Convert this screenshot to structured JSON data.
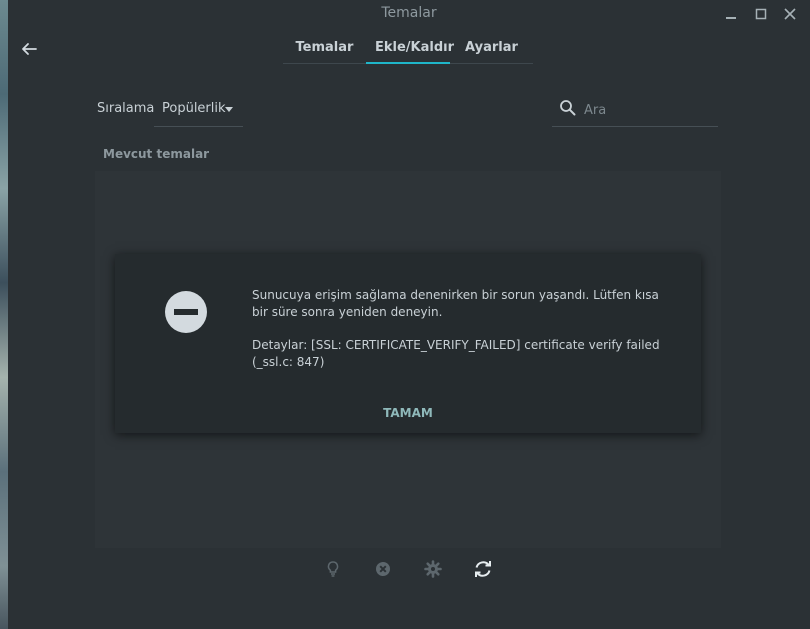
{
  "window": {
    "title": "Temalar",
    "controls": [
      "minimize-icon",
      "maximize-icon",
      "close-icon"
    ]
  },
  "toolbar": {
    "back_icon": "arrow-left-icon"
  },
  "tabs": [
    {
      "label": "Temalar",
      "active": false
    },
    {
      "label": "Ekle/Kaldır",
      "active": true
    },
    {
      "label": "Ayarlar",
      "active": false
    }
  ],
  "filters": {
    "sort_label": "Sıralama",
    "sort_value": "Popülerlik",
    "search_placeholder": "Ara"
  },
  "list": {
    "header": "Mevcut temalar"
  },
  "dialog": {
    "message": "Sunucuya erişim sağlama denenirken bir sorun yaşandı. Lütfen kısa bir süre sonra yeniden deneyin.",
    "details": "Detaylar: [SSL: CERTIFICATE_VERIFY_FAILED] certificate verify failed (_ssl.c: 847)",
    "ok_label": "TAMAM",
    "icon": "error-minus-icon"
  },
  "bottom_actions": [
    "lightbulb-icon",
    "remove-icon",
    "settings-gear-icon",
    "refresh-icon"
  ],
  "colors": {
    "accent": "#1fb6c9",
    "background": "#2b3135",
    "dialog": "#252b2e",
    "ok_text": "#8fb9ba"
  }
}
